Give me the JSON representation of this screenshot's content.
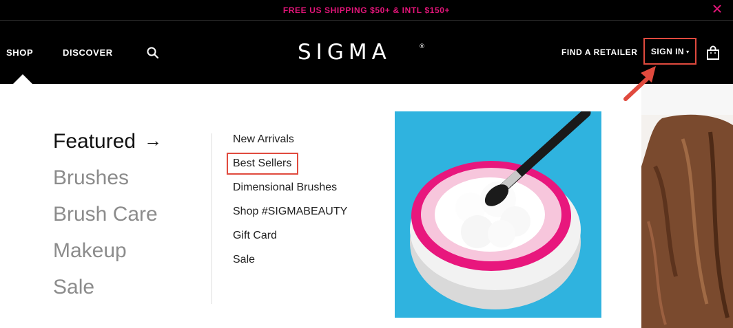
{
  "promo": {
    "text": "FREE US SHIPPING $50+ & INTL $150+",
    "close_icon": "close-icon"
  },
  "nav": {
    "shop": "SHOP",
    "discover": "DISCOVER",
    "search_icon": "search-icon",
    "logo": "SIGMA",
    "logo_mark": "®",
    "find_retailer": "FIND A RETAILER",
    "sign_in": "SIGN IN",
    "sign_in_caret": "▾",
    "bag_icon": "shopping-bag-icon"
  },
  "menu": {
    "categories": [
      "Featured",
      "Brushes",
      "Brush Care",
      "Makeup",
      "Sale"
    ],
    "featured_arrow": "→",
    "subitems": [
      "New Arrivals",
      "Best Sellers",
      "Dimensional Brushes",
      "Shop #SIGMABEAUTY",
      "Gift Card",
      "Sale"
    ]
  },
  "colors": {
    "accent_pink": "#e5157a",
    "highlight_red": "#e04a3e",
    "nav_bg": "#000000",
    "inactive_category": "#8c8c8c"
  }
}
